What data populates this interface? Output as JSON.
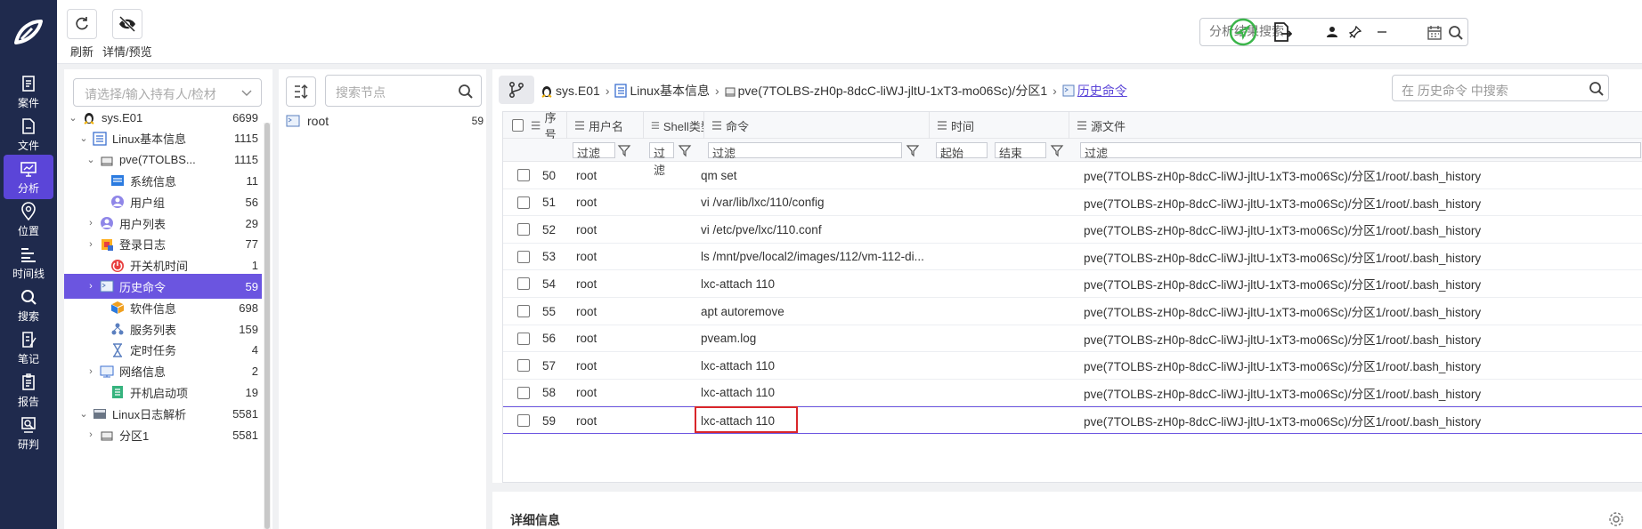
{
  "nav": {
    "items": [
      {
        "label": "案件",
        "icon": "case-icon"
      },
      {
        "label": "文件",
        "icon": "file-icon"
      },
      {
        "label": "分析",
        "icon": "analysis-icon",
        "active": true
      },
      {
        "label": "位置",
        "icon": "location-icon"
      },
      {
        "label": "时间线",
        "icon": "timeline-icon"
      },
      {
        "label": "搜索",
        "icon": "search-icon"
      },
      {
        "label": "笔记",
        "icon": "note-icon"
      },
      {
        "label": "报告",
        "icon": "report-icon"
      },
      {
        "label": "研判",
        "icon": "judge-icon"
      }
    ]
  },
  "toolbar": {
    "refresh_label": "刷新",
    "details_label": "详情/预览",
    "search_placeholder": "分析结果搜索"
  },
  "tree": {
    "select_placeholder": "请选择/输入持有人/检材",
    "rows": [
      {
        "label": "sys.E01",
        "count": "6699",
        "caret": "v",
        "icon": "linux-icon"
      },
      {
        "label": "Linux基本信息",
        "count": "1115",
        "caret": "v",
        "icon": "list-icon"
      },
      {
        "label": "pve(7TOLBS...",
        "count": "1115",
        "caret": "v",
        "icon": "disk-icon"
      },
      {
        "label": "系统信息",
        "count": "11",
        "caret": "",
        "icon": "system-info-icon"
      },
      {
        "label": "用户组",
        "count": "56",
        "caret": "",
        "icon": "user-group-icon"
      },
      {
        "label": "用户列表",
        "count": "29",
        "caret": ">",
        "icon": "user-list-icon"
      },
      {
        "label": "登录日志",
        "count": "77",
        "caret": ">",
        "icon": "login-log-icon"
      },
      {
        "label": "开关机时间",
        "count": "1",
        "caret": "",
        "icon": "power-icon"
      },
      {
        "label": "历史命令",
        "count": "59",
        "caret": ">",
        "icon": "history-command-icon",
        "active": true
      },
      {
        "label": "软件信息",
        "count": "698",
        "caret": "",
        "icon": "software-icon"
      },
      {
        "label": "服务列表",
        "count": "159",
        "caret": "",
        "icon": "service-icon"
      },
      {
        "label": "定时任务",
        "count": "4",
        "caret": "",
        "icon": "hourglass-icon"
      },
      {
        "label": "网络信息",
        "count": "2",
        "caret": ">",
        "icon": "network-icon"
      },
      {
        "label": "开机启动项",
        "count": "19",
        "caret": "",
        "icon": "startup-icon"
      },
      {
        "label": "Linux日志解析",
        "count": "5581",
        "caret": "v",
        "icon": "log-icon"
      },
      {
        "label": "分区1",
        "count": "5581",
        "caret": ">",
        "icon": "disk-icon"
      }
    ]
  },
  "nodes": {
    "search_placeholder": "搜索节点",
    "items": [
      {
        "label": "root",
        "count": "59"
      }
    ]
  },
  "breadcrumb": {
    "items": [
      "sys.E01",
      "Linux基本信息",
      "pve(7TOLBS-zH0p-8dcC-liWJ-jltU-1xT3-mo06Sc)/分区1",
      "历史命令"
    ],
    "search_placeholder": "在 历史命令 中搜索"
  },
  "grid": {
    "columns": [
      "序号",
      "用户名",
      "Shell类型",
      "命令",
      "时间",
      "源文件"
    ],
    "filters": {
      "text": "过滤",
      "start": "起始",
      "end": "结束"
    },
    "rows": [
      {
        "seq": "50",
        "user": "root",
        "cmd": "qm set",
        "src": "pve(7TOLBS-zH0p-8dcC-liWJ-jltU-1xT3-mo06Sc)/分区1/root/.bash_history"
      },
      {
        "seq": "51",
        "user": "root",
        "cmd": "vi /var/lib/lxc/110/config",
        "src": "pve(7TOLBS-zH0p-8dcC-liWJ-jltU-1xT3-mo06Sc)/分区1/root/.bash_history"
      },
      {
        "seq": "52",
        "user": "root",
        "cmd": "vi /etc/pve/lxc/110.conf",
        "src": "pve(7TOLBS-zH0p-8dcC-liWJ-jltU-1xT3-mo06Sc)/分区1/root/.bash_history"
      },
      {
        "seq": "53",
        "user": "root",
        "cmd": "ls /mnt/pve/local2/images/112/vm-112-di...",
        "src": "pve(7TOLBS-zH0p-8dcC-liWJ-jltU-1xT3-mo06Sc)/分区1/root/.bash_history"
      },
      {
        "seq": "54",
        "user": "root",
        "cmd": "lxc-attach 110",
        "src": "pve(7TOLBS-zH0p-8dcC-liWJ-jltU-1xT3-mo06Sc)/分区1/root/.bash_history"
      },
      {
        "seq": "55",
        "user": "root",
        "cmd": "apt autoremove",
        "src": "pve(7TOLBS-zH0p-8dcC-liWJ-jltU-1xT3-mo06Sc)/分区1/root/.bash_history"
      },
      {
        "seq": "56",
        "user": "root",
        "cmd": "pveam.log",
        "src": "pve(7TOLBS-zH0p-8dcC-liWJ-jltU-1xT3-mo06Sc)/分区1/root/.bash_history"
      },
      {
        "seq": "57",
        "user": "root",
        "cmd": "lxc-attach 110",
        "src": "pve(7TOLBS-zH0p-8dcC-liWJ-jltU-1xT3-mo06Sc)/分区1/root/.bash_history"
      },
      {
        "seq": "58",
        "user": "root",
        "cmd": "lxc-attach 110",
        "src": "pve(7TOLBS-zH0p-8dcC-liWJ-jltU-1xT3-mo06Sc)/分区1/root/.bash_history"
      },
      {
        "seq": "59",
        "user": "root",
        "cmd": "lxc-attach 110",
        "src": "pve(7TOLBS-zH0p-8dcC-liWJ-jltU-1xT3-mo06Sc)/分区1/root/.bash_history",
        "highlight": true
      }
    ]
  },
  "detail": {
    "title": "详细信息"
  },
  "colors": {
    "accent": "#5b45d8",
    "nav_bg": "#1f2a4d",
    "highlight_border": "#d9262a",
    "active_tree": "#6b55e0"
  }
}
